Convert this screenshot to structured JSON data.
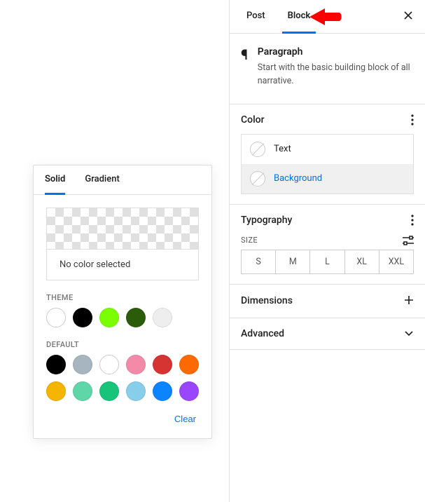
{
  "popup": {
    "tabs": {
      "solid": "Solid",
      "gradient": "Gradient"
    },
    "no_color": "No color selected",
    "theme_label": "THEME",
    "default_label": "DEFAULT",
    "clear": "Clear",
    "theme_colors": [
      "#ffffff",
      "#000000",
      "#7bff00",
      "#2b5c0a",
      "#eeeeee"
    ],
    "default_colors": [
      "#000000",
      "#a6b5bf",
      "#ffffff",
      "#f38ba8",
      "#d63333",
      "#ff6a00",
      "#f5b400",
      "#5fd6a8",
      "#18c47a",
      "#87ceeb",
      "#0a84ff",
      "#9a46ff"
    ]
  },
  "sidebar": {
    "tabs": {
      "post": "Post",
      "block": "Block"
    },
    "block": {
      "title": "Paragraph",
      "desc": "Start with the basic building block of all narrative."
    },
    "panels": {
      "color": {
        "title": "Color",
        "text": "Text",
        "background": "Background"
      },
      "typography": {
        "title": "Typography",
        "size_label": "SIZE",
        "sizes": [
          "S",
          "M",
          "L",
          "XL",
          "XXL"
        ]
      },
      "dimensions": {
        "title": "Dimensions"
      },
      "advanced": {
        "title": "Advanced"
      }
    }
  }
}
